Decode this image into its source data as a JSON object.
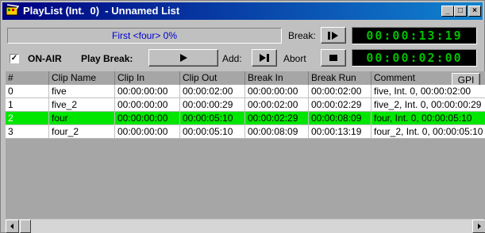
{
  "window": {
    "title": "PlayList (Int.  0)  - Unnamed List",
    "minimize_glyph": "_",
    "maximize_glyph": "□",
    "close_glyph": "×"
  },
  "status": {
    "text": "First <four> 0%"
  },
  "break_controls": {
    "break_label": "Break:",
    "break_timer": "00:00:13:19",
    "on_air_label": "ON-AIR",
    "on_air_checked": true,
    "play_break_label": "Play Break:",
    "add_label": "Add:",
    "abort_label": "Abort",
    "abort_timer": "00:00:02:00"
  },
  "grid": {
    "columns": [
      "#",
      "Clip Name",
      "Clip In",
      "Clip Out",
      "Break In",
      "Break Run",
      "Comment"
    ],
    "gpi_label": "GPI",
    "rows": [
      {
        "num": "0",
        "clip_name": "five",
        "clip_in": "00:00:00:00",
        "clip_out": "00:00:02:00",
        "break_in": "00:00:00:00",
        "break_run": "00:00:02:00",
        "comment": "five, Int.  0, 00:00:02:00",
        "selected": false
      },
      {
        "num": "1",
        "clip_name": "five_2",
        "clip_in": "00:00:00:00",
        "clip_out": "00:00:00:29",
        "break_in": "00:00:02:00",
        "break_run": "00:00:02:29",
        "comment": "five_2, Int.  0, 00:00:00:29",
        "selected": false
      },
      {
        "num": "2",
        "clip_name": "four",
        "clip_in": "00:00:00:00",
        "clip_out": "00:00:05:10",
        "break_in": "00:00:02:29",
        "break_run": "00:00:08:09",
        "comment": "four, Int.  0, 00:00:05:10",
        "selected": true
      },
      {
        "num": "3",
        "clip_name": "four_2",
        "clip_in": "00:00:00:00",
        "clip_out": "00:00:05:10",
        "break_in": "00:00:08:09",
        "break_run": "00:00:13:19",
        "comment": "four_2, Int.  0, 00:00:05:10",
        "selected": false
      }
    ]
  },
  "icons": {
    "app": "filmstrip-icon",
    "play_break": "play-icon",
    "break": "play-to-end-icon",
    "add": "play-to-end-icon",
    "abort": "stop-icon"
  },
  "colors": {
    "title_bar": "#000080",
    "status_text": "#0000cc",
    "lcd_background": "#000000",
    "lcd_digits": "#00c000",
    "selected_row": "#00e600"
  }
}
